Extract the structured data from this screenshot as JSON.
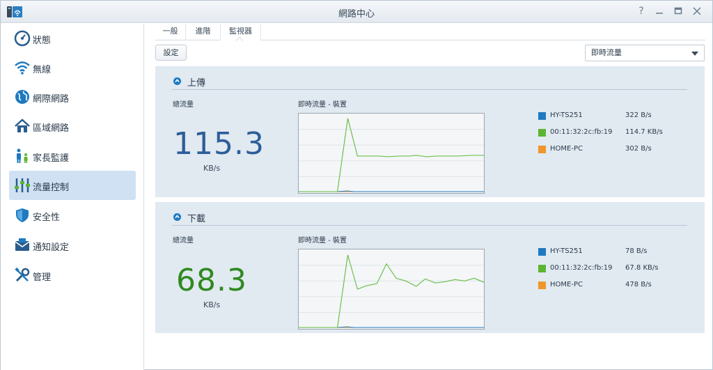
{
  "window": {
    "title": "網路中心",
    "controls": [
      "help",
      "minimize",
      "maximize",
      "close"
    ]
  },
  "sidebar": {
    "items": [
      {
        "label": "狀態",
        "icon": "gauge-icon"
      },
      {
        "label": "無線",
        "icon": "wifi-icon"
      },
      {
        "label": "網際網路",
        "icon": "globe-icon"
      },
      {
        "label": "區域網路",
        "icon": "home-icon"
      },
      {
        "label": "家長監護",
        "icon": "family-icon"
      },
      {
        "label": "流量控制",
        "icon": "sliders-icon",
        "active": true
      },
      {
        "label": "安全性",
        "icon": "shield-icon"
      },
      {
        "label": "通知設定",
        "icon": "mail-icon"
      },
      {
        "label": "管理",
        "icon": "tools-icon"
      }
    ]
  },
  "tabs": [
    {
      "label": "一般"
    },
    {
      "label": "進階"
    },
    {
      "label": "監視器",
      "active": true
    }
  ],
  "toolbar": {
    "settings_label": "設定",
    "view_select": "即時流量"
  },
  "upload": {
    "title": "上傳",
    "total_label": "總流量",
    "total_value": "115.3",
    "total_unit": "KB/s",
    "chart_title": "即時流量 - 裝置",
    "devices": [
      {
        "name": "HY-TS251",
        "value": "322 B/s",
        "color": "#1f7ac0"
      },
      {
        "name": "00:11:32:2c:fb:19",
        "value": "114.7 KB/s",
        "color": "#5cb531"
      },
      {
        "name": "HOME-PC",
        "value": "302 B/s",
        "color": "#f0962a"
      }
    ]
  },
  "download": {
    "title": "下載",
    "total_label": "總流量",
    "total_value": "68.3",
    "total_unit": "KB/s",
    "chart_title": "即時流量 - 裝置",
    "devices": [
      {
        "name": "HY-TS251",
        "value": "78 B/s",
        "color": "#1f7ac0"
      },
      {
        "name": "00:11:32:2c:fb:19",
        "value": "67.8 KB/s",
        "color": "#5cb531"
      },
      {
        "name": "HOME-PC",
        "value": "478 B/s",
        "color": "#f0962a"
      }
    ]
  },
  "colors": {
    "upload_number": "#2c5e99",
    "download_number": "#2e8a1f",
    "accent": "#1f7ac0",
    "active_nav": "#cfe1f3"
  }
}
